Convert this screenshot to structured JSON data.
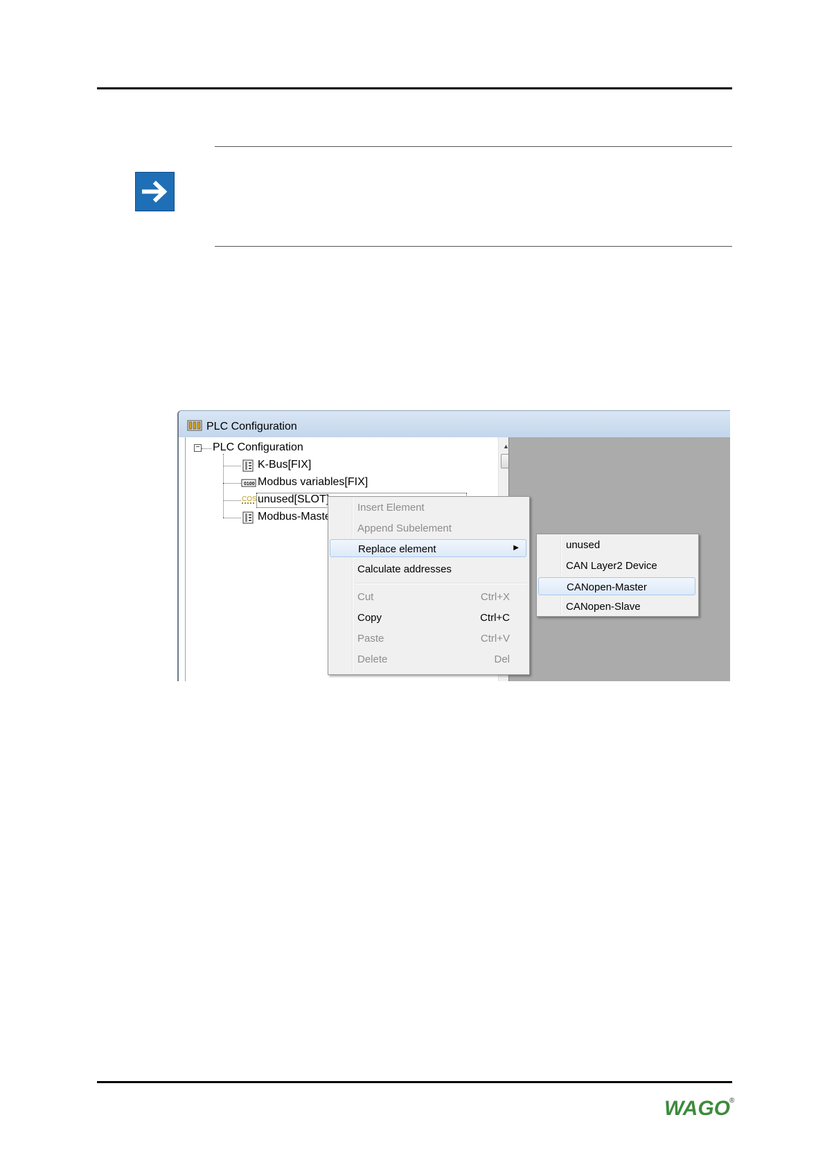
{
  "window": {
    "title": "PLC Configuration",
    "tree": {
      "root": "PLC Configuration",
      "items": [
        "K-Bus[FIX]",
        "Modbus variables[FIX]",
        "unused[SLOT]",
        "Modbus-Maste"
      ],
      "icon_labels": {
        "modbus": "0100",
        "slot": "COS"
      }
    }
  },
  "context_menu": {
    "items": [
      {
        "label": "Insert Element",
        "shortcut": "",
        "enabled": false
      },
      {
        "label": "Append Subelement",
        "shortcut": "",
        "enabled": false
      },
      {
        "label": "Replace element",
        "shortcut": "",
        "enabled": true,
        "highlighted": true,
        "has_submenu": true
      },
      {
        "label": "Calculate addresses",
        "shortcut": "",
        "enabled": true
      },
      {
        "label": "Cut",
        "shortcut": "Ctrl+X",
        "enabled": false
      },
      {
        "label": "Copy",
        "shortcut": "Ctrl+C",
        "enabled": true
      },
      {
        "label": "Paste",
        "shortcut": "Ctrl+V",
        "enabled": false
      },
      {
        "label": "Delete",
        "shortcut": "Del",
        "enabled": false
      }
    ]
  },
  "submenu": {
    "items": [
      {
        "label": "unused"
      },
      {
        "label": "CAN Layer2 Device"
      },
      {
        "label": "CANopen-Master",
        "highlighted": true
      },
      {
        "label": "CANopen-Slave"
      }
    ]
  },
  "footer": {
    "logo_text": "WAGO",
    "registered_mark": "®"
  },
  "colors": {
    "note_icon": "#1f6fb6",
    "logo_green": "#3d8b3d",
    "menu_highlight_border": "#a8c8ec",
    "right_pane": "#ababab"
  }
}
